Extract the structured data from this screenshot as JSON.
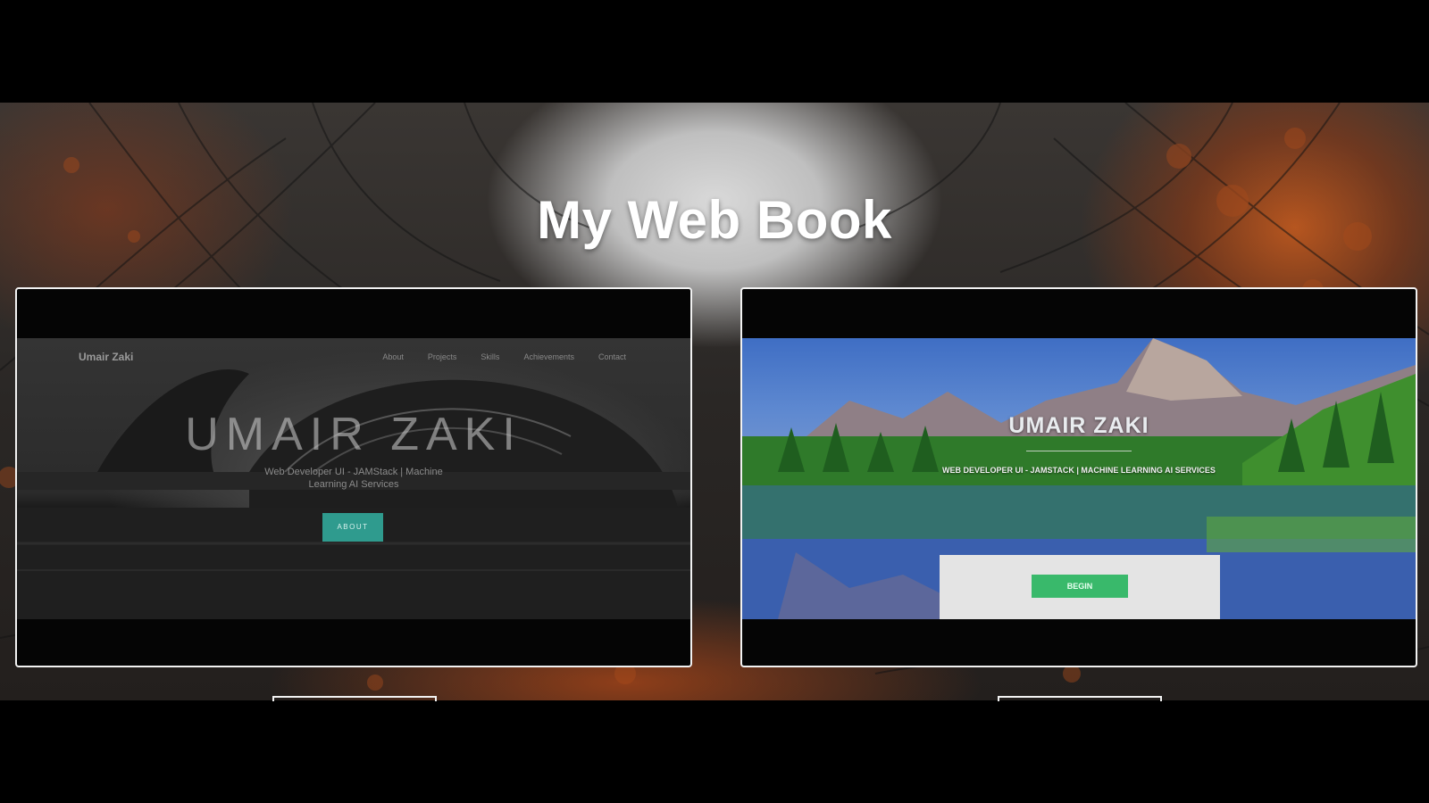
{
  "page": {
    "title": "My Web Book"
  },
  "cards": [
    {
      "kind": "dark-architecture",
      "brand": "Umair Zaki",
      "nav": [
        "About",
        "Projects",
        "Skills",
        "Achievements",
        "Contact"
      ],
      "hero_name": "UMAIR ZAKI",
      "hero_subtitle": "Web Developer UI - JAMStack | Machine Learning AI Services",
      "button_label": "ABOUT",
      "accent": "#2f9b8e"
    },
    {
      "kind": "mountain-lake",
      "hero_name": "UMAIR ZAKI",
      "hero_subtitle": "WEB DEVELOPER UI - JAMSTACK | MACHINE LEARNING AI SERVICES",
      "button_label": "BEGIN",
      "accent": "#39b96b"
    }
  ]
}
